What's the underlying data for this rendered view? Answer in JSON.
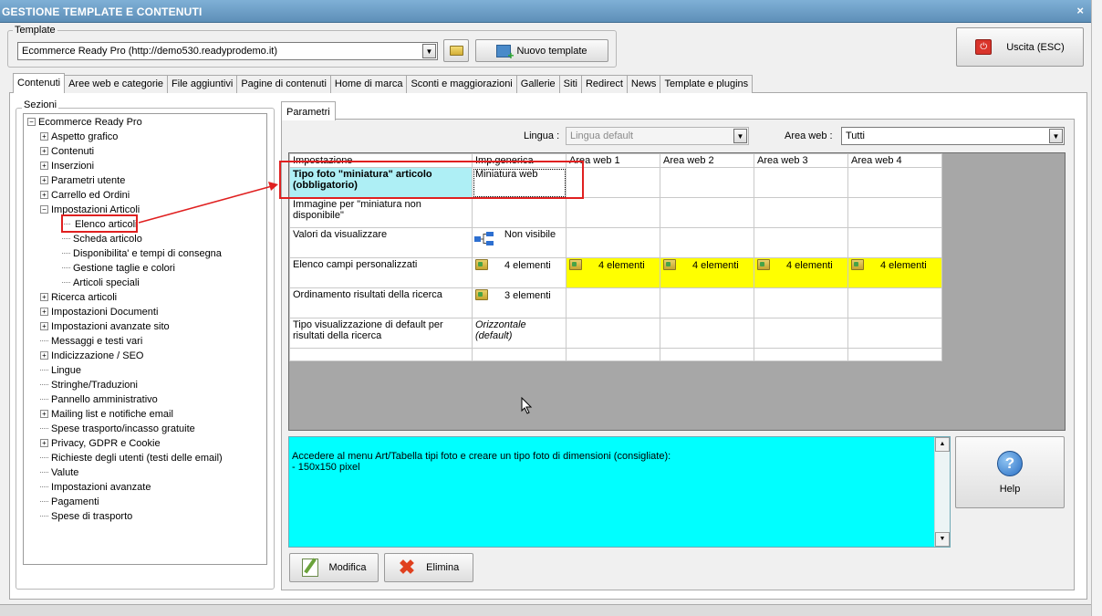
{
  "window": {
    "title": "GESTIONE TEMPLATE E CONTENUTI",
    "close_glyph": "×"
  },
  "template_group": {
    "label": "Template",
    "selected": "Ecommerce Ready Pro (http://demo530.readyprodemo.it)",
    "new_button": "Nuovo template"
  },
  "exit_button": "Uscita (ESC)",
  "tabs": [
    "Contenuti",
    "Aree web e categorie",
    "File aggiuntivi",
    "Pagine di contenuti",
    "Home di marca",
    "Sconti e maggiorazioni",
    "Gallerie",
    "Siti",
    "Redirect",
    "News",
    "Template e plugins"
  ],
  "active_tab": "Contenuti",
  "sections": {
    "label": "Sezioni",
    "root": "Ecommerce Ready Pro",
    "items": [
      {
        "label": "Aspetto grafico",
        "expandable": true
      },
      {
        "label": "Contenuti",
        "expandable": true
      },
      {
        "label": "Inserzioni",
        "expandable": true
      },
      {
        "label": "Parametri utente",
        "expandable": true
      },
      {
        "label": "Carrello ed Ordini",
        "expandable": true
      },
      {
        "label": "Impostazioni Articoli",
        "expandable": true,
        "expanded": true
      },
      {
        "label": "Elenco articoli",
        "child": true,
        "selected": true
      },
      {
        "label": "Scheda articolo",
        "child": true
      },
      {
        "label": "Disponibilita' e tempi di consegna",
        "child": true
      },
      {
        "label": "Gestione taglie e colori",
        "child": true
      },
      {
        "label": "Articoli speciali",
        "child": true
      },
      {
        "label": "Ricerca articoli",
        "expandable": true
      },
      {
        "label": "Impostazioni Documenti",
        "expandable": true
      },
      {
        "label": "Impostazioni avanzate sito",
        "expandable": true
      },
      {
        "label": "Messaggi e testi vari",
        "expandable": false
      },
      {
        "label": "Indicizzazione / SEO",
        "expandable": true
      },
      {
        "label": "Lingue",
        "expandable": false
      },
      {
        "label": "Stringhe/Traduzioni",
        "expandable": false
      },
      {
        "label": "Pannello amministrativo",
        "expandable": false
      },
      {
        "label": "Mailing list e notifiche email",
        "expandable": true
      },
      {
        "label": "Spese trasporto/incasso gratuite",
        "expandable": false
      },
      {
        "label": "Privacy, GDPR e Cookie",
        "expandable": true
      },
      {
        "label": "Richieste degli utenti (testi delle email)",
        "expandable": false
      },
      {
        "label": "Valute",
        "expandable": false
      },
      {
        "label": "Impostazioni avanzate",
        "expandable": false
      },
      {
        "label": "Pagamenti",
        "expandable": false
      },
      {
        "label": "Spese di trasporto",
        "expandable": false
      }
    ]
  },
  "params": {
    "tab": "Parametri",
    "lingua_label": "Lingua :",
    "lingua_value": "Lingua default",
    "area_label": "Area web :",
    "area_value": "Tutti",
    "columns": [
      "Impostazione",
      "Imp.generica",
      "Area web 1",
      "Area web 2",
      "Area web 3",
      "Area web 4"
    ],
    "rows": [
      {
        "name": "Tipo foto \"miniatura\" articolo (obbligatorio)",
        "generic": "Miniatura web",
        "areas": [
          "",
          "",
          "",
          ""
        ]
      },
      {
        "name": "Immagine per \"miniatura non disponibile\"",
        "generic": "",
        "areas": [
          "",
          "",
          "",
          ""
        ]
      },
      {
        "name": "Valori da visualizzare",
        "generic": "Non visibile",
        "areas": [
          "",
          "",
          "",
          ""
        ]
      },
      {
        "name": "Elenco campi personalizzati",
        "generic": "4 elementi",
        "areas": [
          "4 elementi",
          "4 elementi",
          "4 elementi",
          "4 elementi"
        ]
      },
      {
        "name": "Ordinamento risultati della ricerca",
        "generic": "3 elementi",
        "areas": [
          "",
          "",
          "",
          ""
        ]
      },
      {
        "name": "Tipo visualizzazione di default per risultati della ricerca",
        "generic": "Orizzontale (default)",
        "areas": [
          "",
          "",
          "",
          ""
        ]
      }
    ],
    "description": "Accedere al menu Art/Tabella tipi foto e creare un tipo foto di dimensioni (consigliate):\n- 150x150 pixel",
    "help_button": "Help",
    "edit_button": "Modifica",
    "delete_button": "Elimina"
  },
  "colors": {
    "highlight_cell": "#aeeff5",
    "custom_fields_bg": "#ffff00",
    "description_bg": "#00ffff",
    "annotation": "#e02020"
  }
}
